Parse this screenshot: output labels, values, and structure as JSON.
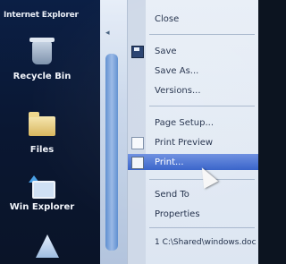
{
  "desktop": {
    "window_title": "Internet Explorer",
    "icons": [
      {
        "label": "Recycle Bin",
        "icon": "recycle-bin-icon"
      },
      {
        "label": "Files",
        "icon": "folder-icon"
      },
      {
        "label": "Win Explorer",
        "icon": "explorer-icon"
      }
    ]
  },
  "window": {
    "tab_glyph": "◂"
  },
  "file_menu": {
    "items": [
      {
        "label": "Close"
      },
      {
        "label": "Save",
        "icon": "save-icon"
      },
      {
        "label": "Save As..."
      },
      {
        "label": "Versions..."
      },
      {
        "label": "Page Setup..."
      },
      {
        "label": "Print Preview",
        "icon": "print-preview-icon"
      },
      {
        "label": "Print...",
        "icon": "print-icon",
        "highlighted": true
      },
      {
        "label": "Send To"
      },
      {
        "label": "Properties"
      },
      {
        "label": "1 C:\\Shared\\windows.doc"
      }
    ]
  },
  "colors": {
    "menu_highlight": "#3561c9",
    "desktop_background": "#0a1732",
    "menu_background": "#e9eff7"
  }
}
